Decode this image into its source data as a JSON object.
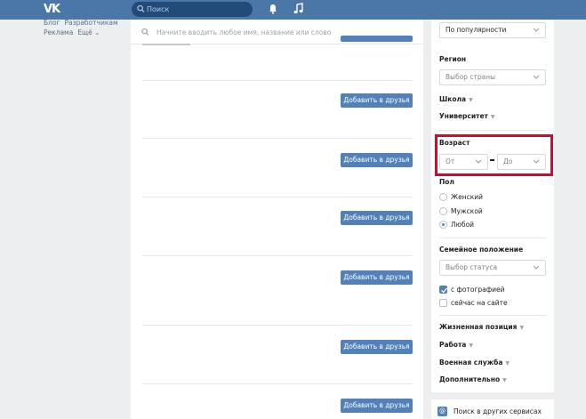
{
  "header": {
    "logo": "VK",
    "search_placeholder": "Поиск"
  },
  "left_links": {
    "blog": "Блог",
    "developers": "Разработчикам",
    "ads": "Реклама",
    "more": "Ещё ⌄"
  },
  "main": {
    "search_placeholder": "Начните вводить любое имя, название или слово",
    "add_friend_label": "Добавить в друзья"
  },
  "filters": {
    "sort_value": "По популярности",
    "region_title": "Регион",
    "country_placeholder": "Выбор страны",
    "school_label": "Школа",
    "university_label": "Университет",
    "age_title": "Возраст",
    "age_from": "От",
    "age_to": "До",
    "sex_title": "Пол",
    "sex_options": [
      "Женский",
      "Мужской",
      "Любой"
    ],
    "sex_selected": "Любой",
    "marital_title": "Семейное положение",
    "marital_placeholder": "Выбор статуса",
    "with_photo_label": "с фотографией",
    "with_photo_checked": true,
    "online_label": "сейчас на сайте",
    "online_checked": false,
    "life_position_label": "Жизненная позиция",
    "work_label": "Работа",
    "military_label": "Военная служба",
    "extra_label": "Дополнительно",
    "other_services_label": "Поиск в других сервисах"
  },
  "colors": {
    "header_bg": "#4a76a8",
    "button_bg": "#5181b8",
    "highlight": "#c8102e",
    "page_bg": "#edeef0"
  }
}
